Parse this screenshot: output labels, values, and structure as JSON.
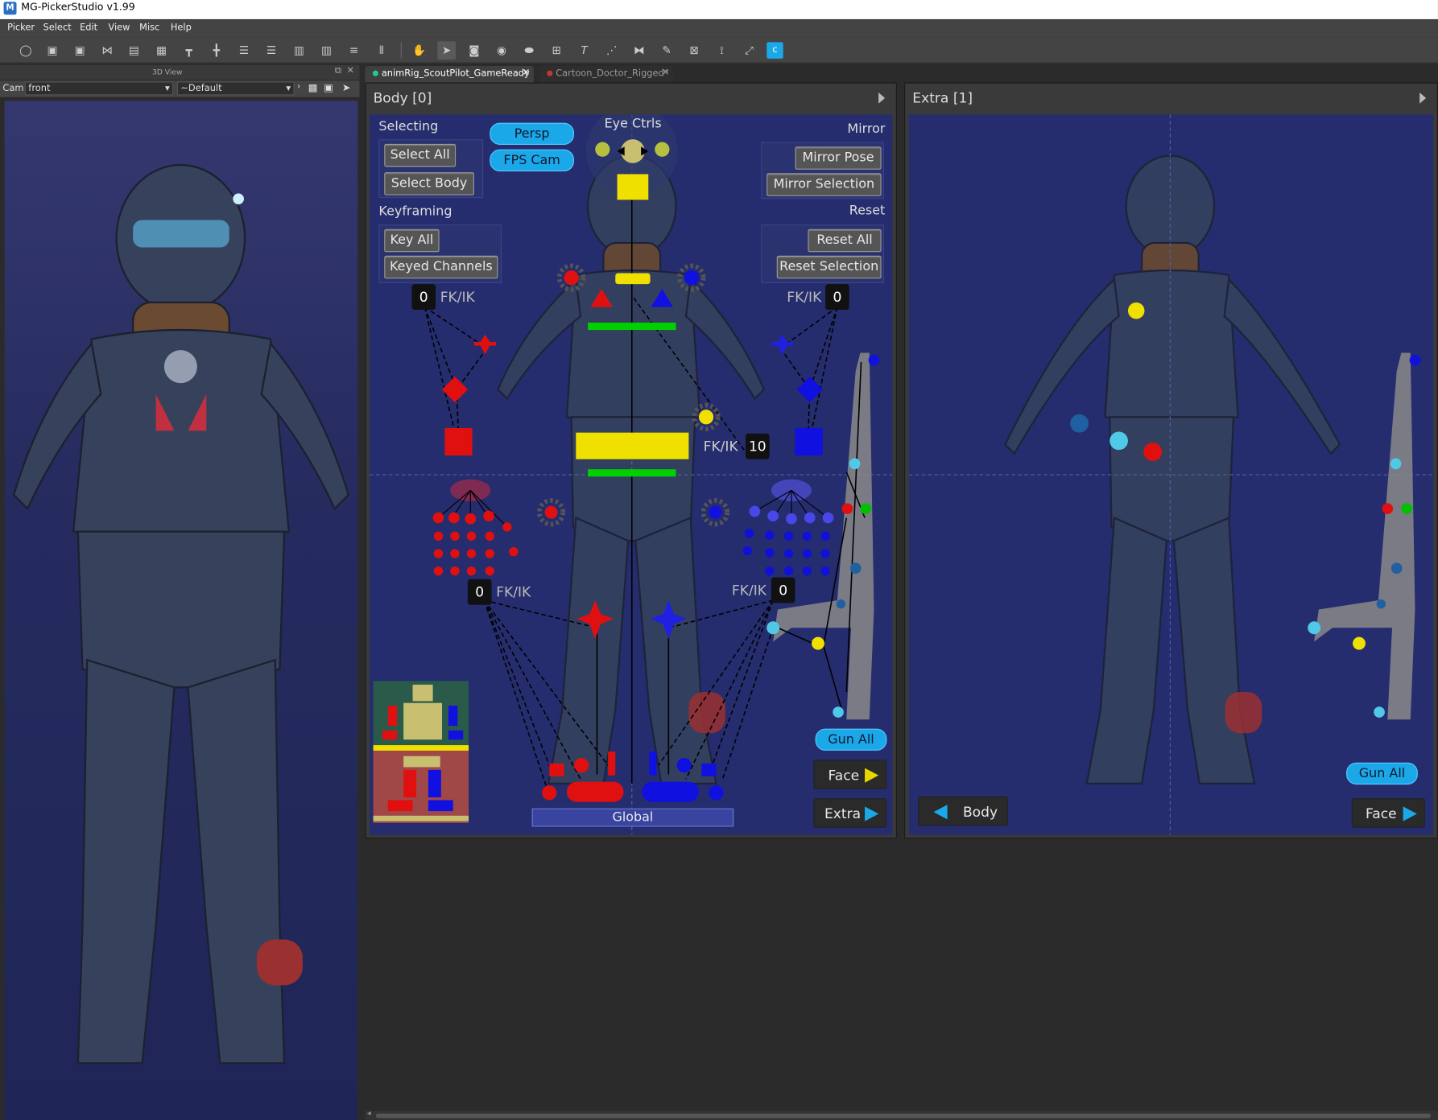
{
  "app": {
    "title": "MG-PickerStudio v1.99",
    "logo": "M"
  },
  "menu": [
    "Picker",
    "Select",
    "Edit",
    "View",
    "Misc",
    "Help"
  ],
  "toolbar_icons": [
    "zoom-icon",
    "export-icon",
    "import-icon",
    "mirror-icon",
    "layout-icon",
    "grid-icon",
    "align-top-icon",
    "align-center-icon",
    "align-left-icon",
    "align-right-icon",
    "distribute-h-icon",
    "distribute-v-icon",
    "list-icon",
    "columns-icon",
    "hand-tool-icon",
    "select-tool-icon",
    "rect-tool-icon",
    "circle-tool-icon",
    "poly-tool-icon",
    "button-tool-icon",
    "text-tool-icon",
    "path-tool-icon",
    "mirror-tool-icon",
    "eyedropper-icon",
    "slider-tool-icon",
    "joint-tool-icon",
    "link-tool-icon",
    "custom-tool-icon"
  ],
  "view3d": {
    "header": "3D View",
    "cam_label": "Cam",
    "cam_value": "front",
    "preset_value": "~Default"
  },
  "tabs": [
    {
      "label": "animRig_ScoutPilot_GameReady",
      "active": true
    },
    {
      "label": "Cartoon_Doctor_Rigged*",
      "active": false
    }
  ],
  "body_panel": {
    "title": "Body [0]",
    "selecting_label": "Selecting",
    "select_all": "Select All",
    "select_body": "Select Body",
    "persp": "Persp",
    "fps_cam": "FPS Cam",
    "eye_ctrls": "Eye Ctrls",
    "mirror_label": "Mirror",
    "mirror_pose": "Mirror Pose",
    "mirror_selection": "Mirror Selection",
    "keyframing_label": "Keyframing",
    "key_all": "Key All",
    "keyed_channels": "Keyed Channels",
    "reset_label": "Reset",
    "reset_all": "Reset All",
    "reset_selection": "Reset Selection",
    "fkik_label": "FK/IK",
    "fkik_arm_r": "0",
    "fkik_arm_l": "0",
    "fkik_spine": "10",
    "fkik_leg_r": "0",
    "fkik_leg_l": "0",
    "gun_all": "Gun All",
    "face": "Face",
    "extra": "Extra",
    "global": "Global"
  },
  "extra_panel": {
    "title": "Extra [1]",
    "body": "Body",
    "gun_all": "Gun All",
    "face": "Face"
  },
  "colors": {
    "canvas": "#252d6e",
    "accent": "#1ba8e8",
    "right_side": "#e01010",
    "left_side": "#1010e0",
    "center": "#f0e000",
    "fk": "#00d000"
  }
}
